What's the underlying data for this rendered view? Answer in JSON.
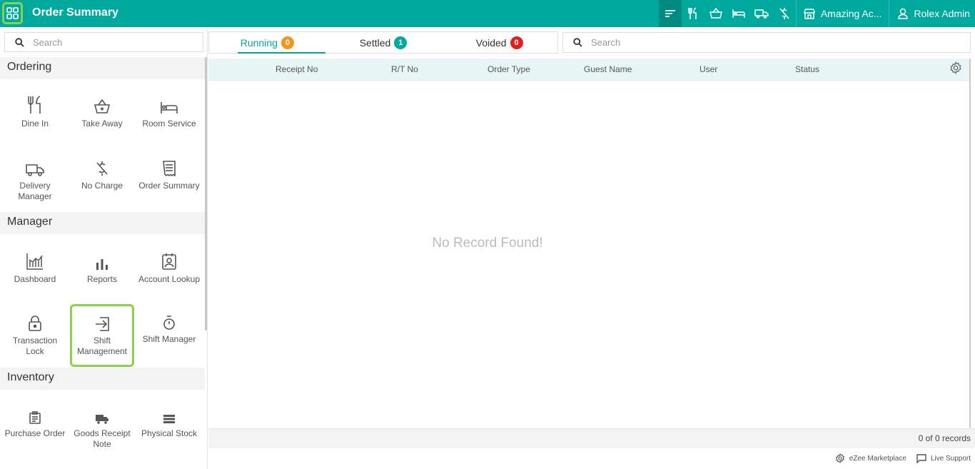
{
  "header": {
    "title": "Order Summary",
    "outlet_name": "Amazing Ac...",
    "user_name": "Rolex Admin"
  },
  "colors": {
    "brand": "#00a99d",
    "highlight": "#8dd04a",
    "badge_running": "#f7941d",
    "badge_settled": "#00a99d",
    "badge_voided": "#e02020"
  },
  "sidebar": {
    "search_placeholder": "Search",
    "sections": {
      "ordering": "Ordering",
      "manager": "Manager",
      "inventory": "Inventory"
    },
    "ordering": [
      "Dine In",
      "Take Away",
      "Room Service",
      "Delivery Manager",
      "No Charge",
      "Order Summary"
    ],
    "manager": [
      "Dashboard",
      "Reports",
      "Account Lookup",
      "Transaction Lock",
      "Shift Management",
      "Shift Manager"
    ],
    "inventory": [
      "Purchase Order",
      "Goods Receipt Note",
      "Physical Stock"
    ]
  },
  "tabs": [
    {
      "label": "Running",
      "count": "0"
    },
    {
      "label": "Settled",
      "count": "1"
    },
    {
      "label": "Voided",
      "count": "0"
    }
  ],
  "search": {
    "placeholder": "Search"
  },
  "table": {
    "columns": [
      "Receipt No",
      "R/T No",
      "Order Type",
      "Guest Name",
      "User",
      "Status"
    ],
    "empty_text": "No Record Found!",
    "records_text": "0 of 0 records"
  },
  "footer": {
    "marketplace": "eZee Marketplace",
    "support": "Live Support"
  }
}
